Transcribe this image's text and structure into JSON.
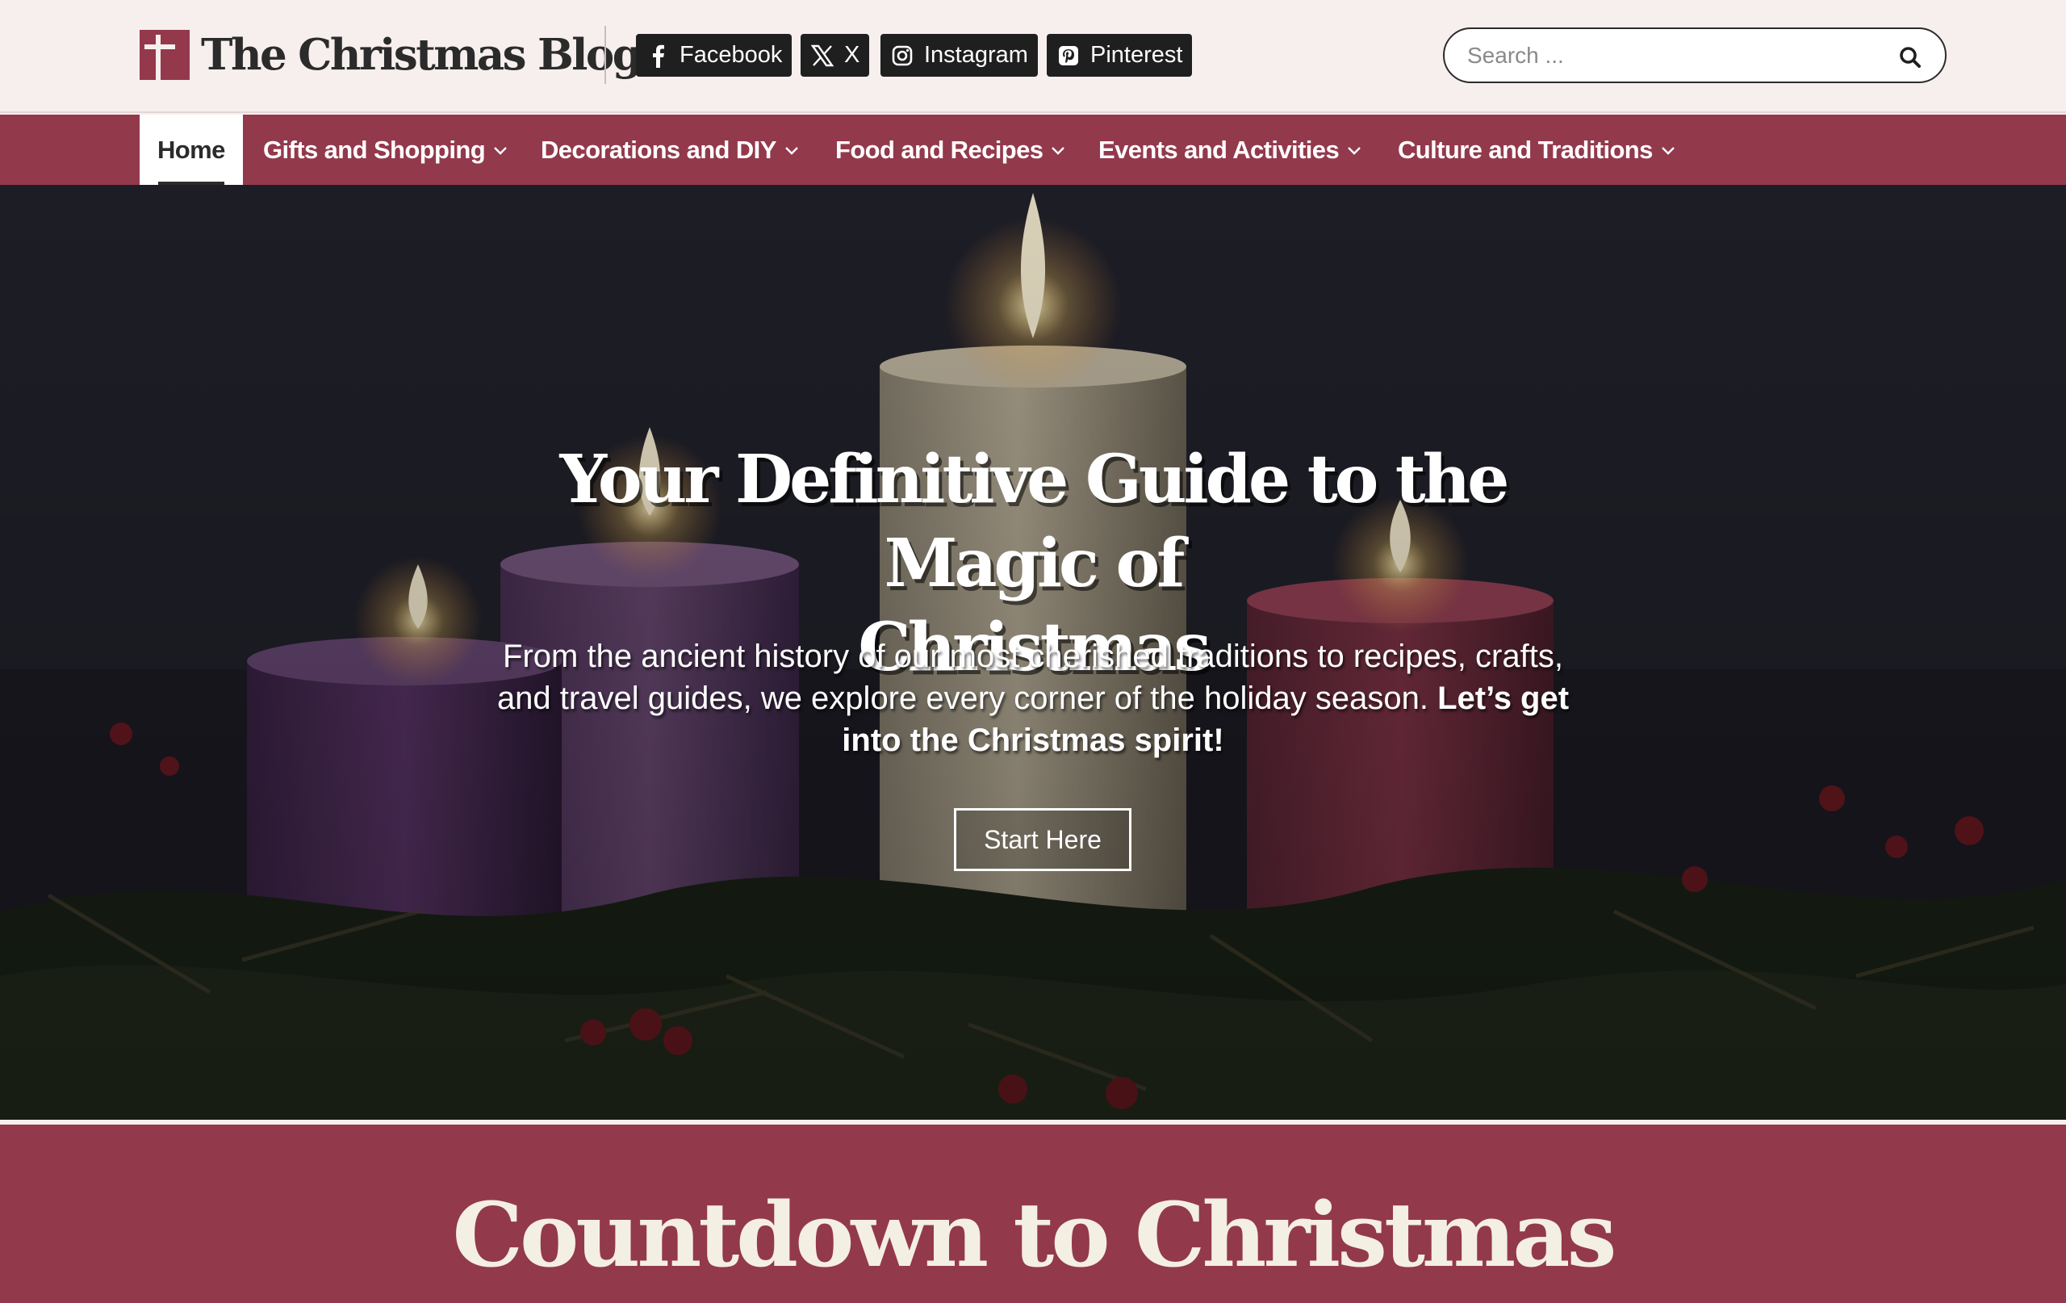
{
  "site": {
    "name": "The Christmas Blog"
  },
  "social": [
    {
      "label": "Facebook",
      "icon": "facebook-icon"
    },
    {
      "label": "X",
      "icon": "x-icon"
    },
    {
      "label": "Instagram",
      "icon": "instagram-icon"
    },
    {
      "label": "Pinterest",
      "icon": "pinterest-icon"
    }
  ],
  "search": {
    "placeholder": "Search ...",
    "value": ""
  },
  "nav": {
    "items": [
      {
        "label": "Home",
        "active": true
      },
      {
        "label": "Gifts and Shopping"
      },
      {
        "label": "Decorations and DIY"
      },
      {
        "label": "Food and Recipes"
      },
      {
        "label": "Events and Activities"
      },
      {
        "label": "Culture and Traditions"
      }
    ]
  },
  "hero": {
    "title_line1": "Your Definitive Guide to the Magic of",
    "title_line2": "Christmas",
    "subtitle_plain": "From the ancient history of our most cherished traditions to recipes, crafts, and travel guides, we explore every corner of the holiday season.",
    "subtitle_bold": "Let’s get into the Christmas spirit!",
    "cta_label": "Start Here"
  },
  "countdown": {
    "title": "Countdown to Christmas"
  },
  "colors": {
    "brand": "#93394c",
    "header_bg": "#f7efee",
    "dark": "#1f1f1f",
    "heading_light": "#f4efe3"
  }
}
